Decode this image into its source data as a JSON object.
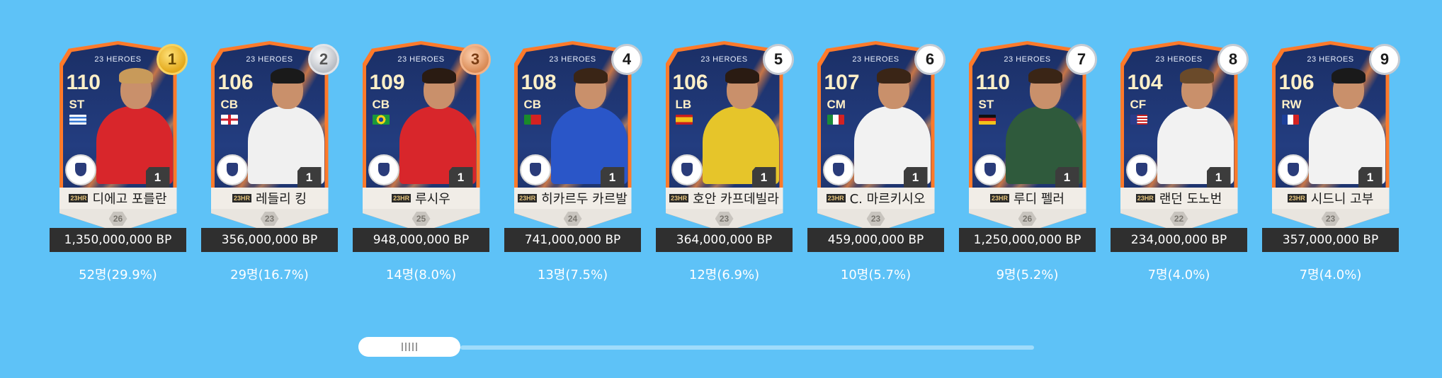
{
  "players": [
    {
      "rank": "1",
      "medal": "gold",
      "season": "23 HEROES",
      "ovr": "110",
      "pos": "ST",
      "flag": "uruguay",
      "name": "디에고 포를란",
      "badge": "23HR",
      "grade": "26",
      "level": "1",
      "price": "1,350,000,000 BP",
      "count": "52명(29.9%)",
      "hair": "#c89a5a",
      "kit": "#d8262b"
    },
    {
      "rank": "2",
      "medal": "silver",
      "season": "23 HEROES",
      "ovr": "106",
      "pos": "CB",
      "flag": "england",
      "name": "레들리 킹",
      "badge": "23HR",
      "grade": "23",
      "level": "1",
      "price": "356,000,000 BP",
      "count": "29명(16.7%)",
      "hair": "#1a1a1a",
      "kit": "#f0f0f0"
    },
    {
      "rank": "3",
      "medal": "bronze",
      "season": "23 HEROES",
      "ovr": "109",
      "pos": "CB",
      "flag": "brazil",
      "name": "루시우",
      "badge": "23HR",
      "grade": "25",
      "level": "1",
      "price": "948,000,000 BP",
      "count": "14명(8.0%)",
      "hair": "#2a1b12",
      "kit": "#d8262b"
    },
    {
      "rank": "4",
      "medal": "",
      "season": "23 HEROES",
      "ovr": "108",
      "pos": "CB",
      "flag": "portugal",
      "name": "히카르두 카르발",
      "badge": "23HR",
      "grade": "24",
      "level": "1",
      "price": "741,000,000 BP",
      "count": "13명(7.5%)",
      "hair": "#3a2516",
      "kit": "#2a56c8"
    },
    {
      "rank": "5",
      "medal": "",
      "season": "23 HEROES",
      "ovr": "106",
      "pos": "LB",
      "flag": "spain",
      "name": "호안 카프데빌라",
      "badge": "23HR",
      "grade": "23",
      "level": "1",
      "price": "364,000,000 BP",
      "count": "12명(6.9%)",
      "hair": "#2a1b12",
      "kit": "#e6c52a"
    },
    {
      "rank": "6",
      "medal": "",
      "season": "23 HEROES",
      "ovr": "107",
      "pos": "CM",
      "flag": "italy",
      "name": "C. 마르키시오",
      "badge": "23HR",
      "grade": "23",
      "level": "1",
      "price": "459,000,000 BP",
      "count": "10명(5.7%)",
      "hair": "#3a2516",
      "kit": "#f2f2f2"
    },
    {
      "rank": "7",
      "medal": "",
      "season": "23 HEROES",
      "ovr": "110",
      "pos": "ST",
      "flag": "germany",
      "name": "루디 펠러",
      "badge": "23HR",
      "grade": "26",
      "level": "1",
      "price": "1,250,000,000 BP",
      "count": "9명(5.2%)",
      "hair": "#3a2516",
      "kit": "#2f5a3c"
    },
    {
      "rank": "8",
      "medal": "",
      "season": "23 HEROES",
      "ovr": "104",
      "pos": "CF",
      "flag": "usa",
      "name": "랜던 도노번",
      "badge": "23HR",
      "grade": "22",
      "level": "1",
      "price": "234,000,000 BP",
      "count": "7명(4.0%)",
      "hair": "#6a4a2a",
      "kit": "#f2f2f2"
    },
    {
      "rank": "9",
      "medal": "",
      "season": "23 HEROES",
      "ovr": "106",
      "pos": "RW",
      "flag": "france",
      "name": "시드니 고부",
      "badge": "23HR",
      "grade": "23",
      "level": "1",
      "price": "357,000,000 BP",
      "count": "7명(4.0%)",
      "hair": "#1a1a1a",
      "kit": "#f2f2f2"
    }
  ],
  "scrollbar": {
    "position": 0.0
  }
}
